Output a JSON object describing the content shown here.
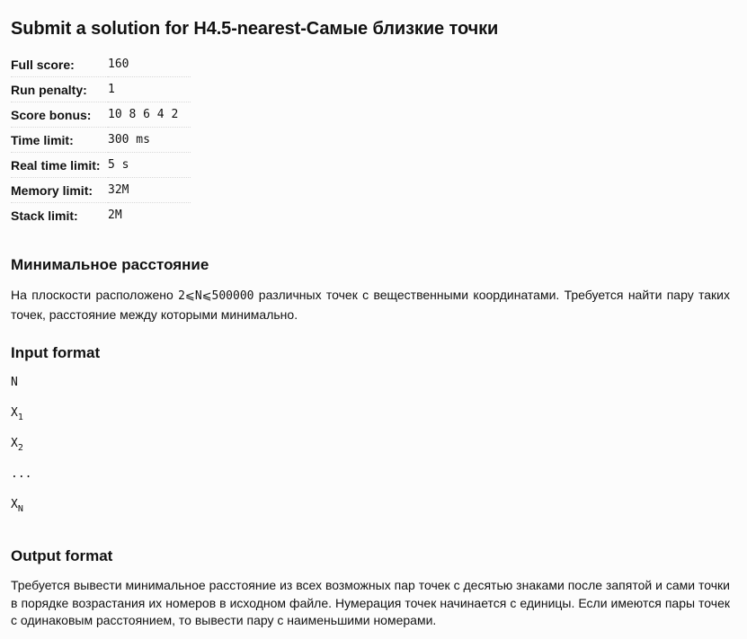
{
  "title": "Submit a solution for H4.5-nearest-Самые близкие точки",
  "limits": [
    {
      "key": "Full score:",
      "value": "160"
    },
    {
      "key": "Run penalty:",
      "value": "1"
    },
    {
      "key": "Score bonus:",
      "value": "10 8 6 4 2"
    },
    {
      "key": "Time limit:",
      "value": "300 ms"
    },
    {
      "key": "Real time limit:",
      "value": "5 s"
    },
    {
      "key": "Memory limit:",
      "value": "32M"
    },
    {
      "key": "Stack limit:",
      "value": "2M"
    }
  ],
  "statement": {
    "title": "Минимальное расстояние",
    "text_before": "На плоскости расположено ",
    "formula": "2⩽N⩽500000",
    "text_after": " различных точек с вещественными координатами. Требуется найти пару таких точек, расстояние между которыми минимально."
  },
  "input_format": {
    "title": "Input format",
    "lines": [
      {
        "base": "N",
        "sub": ""
      },
      {
        "base": "X",
        "sub": "1"
      },
      {
        "base": "X",
        "sub": "2"
      },
      {
        "base": "...",
        "sub": ""
      },
      {
        "base": "X",
        "sub": "N"
      }
    ]
  },
  "output_format": {
    "title": "Output format",
    "text": "Требуется вывести минимальное расстояние из всех возможных пар точек с десятью знаками после запятой и сами точки в порядке возрастания их номеров в исходном файле. Нумерация точек начинается с единицы. Если имеются пары точек с одинаковым расстоянием, то вывести пару с наименьшими номерами."
  }
}
